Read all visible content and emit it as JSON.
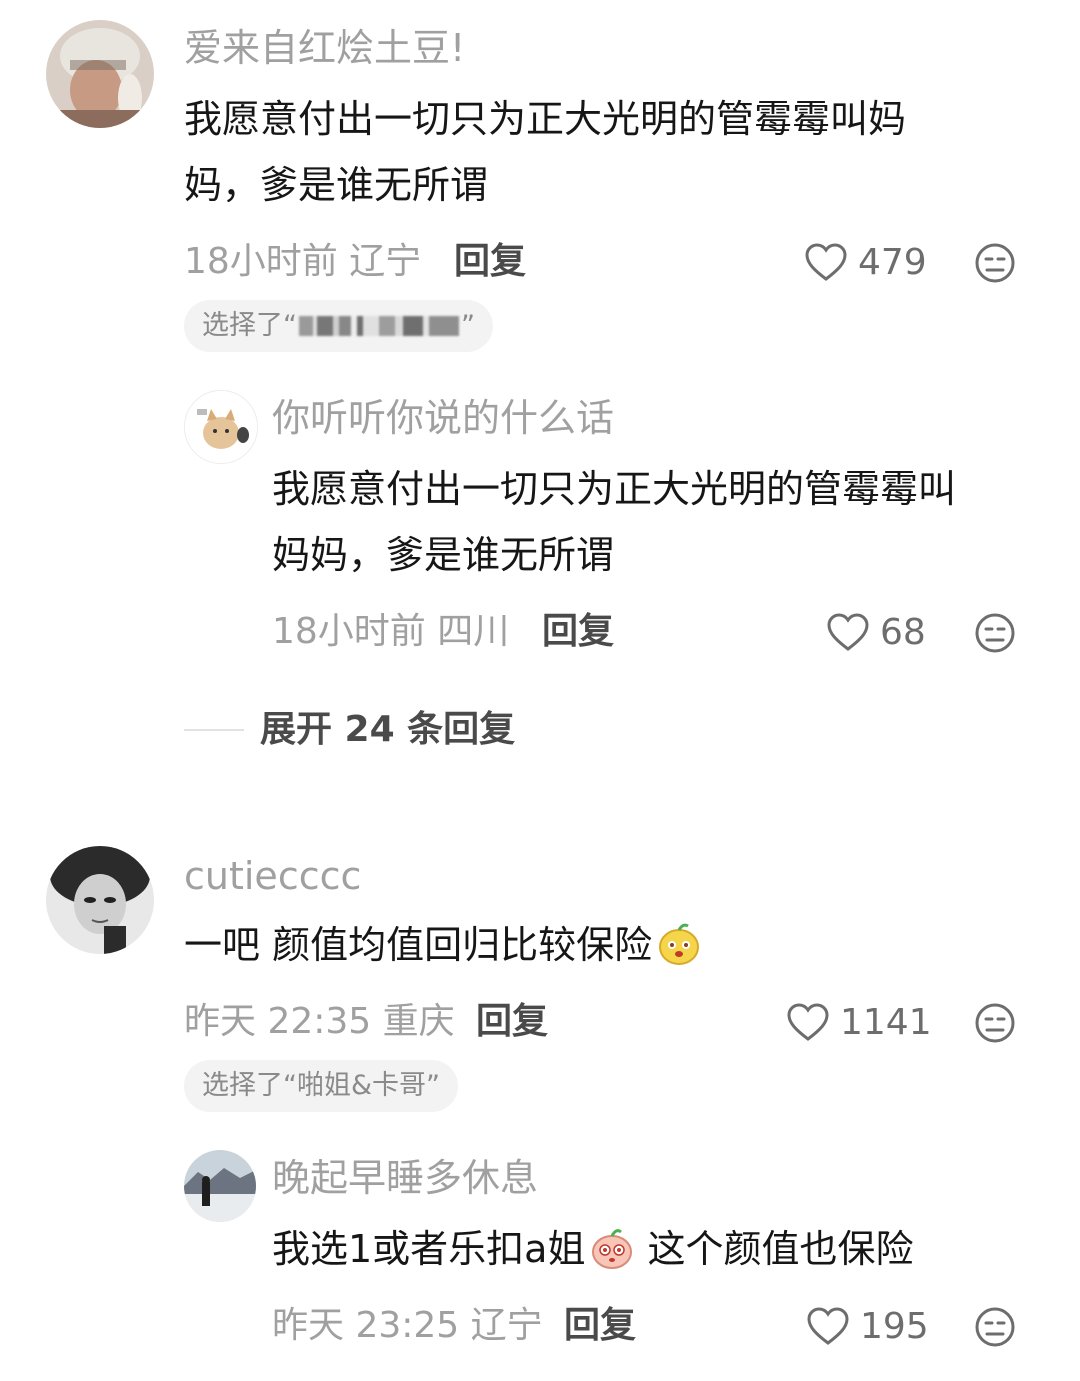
{
  "comments": [
    {
      "username": "爱来自红烩土豆!",
      "content_lines": [
        "我愿意付出一切只为正大光明的管霉霉叫妈",
        "妈，爹是谁无所谓"
      ],
      "time_location": "18小时前 辽宁",
      "reply_label": "回复",
      "likes": "479",
      "chip": {
        "prefix": "选择了“",
        "suffix": "”"
      },
      "replies": [
        {
          "username": "你听听你说的什么话",
          "content_lines": [
            "我愿意付出一切只为正大光明的管霉霉叫",
            "妈妈，爹是谁无所谓"
          ],
          "time_location": "18小时前 四川",
          "reply_label": "回复",
          "likes": "68"
        }
      ],
      "expand_label": "展开 24 条回复"
    },
    {
      "username": "cutiecccc",
      "content_lines": [
        "一吧 颜值均值回归比较保险"
      ],
      "time_location": "昨天 22:35 重庆",
      "reply_label": "回复",
      "likes": "1141",
      "chip": {
        "text": "选择了“啪姐&卡哥”"
      },
      "replies": [
        {
          "username": "晚起早睡多休息",
          "content_before_emoji": "我选1或者乐扣a姐",
          "content_after_emoji": " 这个颜值也保险",
          "time_location": "昨天 23:25 辽宁",
          "reply_label": "回复",
          "likes": "195"
        }
      ]
    }
  ],
  "icons": {
    "like": "heart-outline-icon",
    "dislike": "meh-face-icon"
  }
}
